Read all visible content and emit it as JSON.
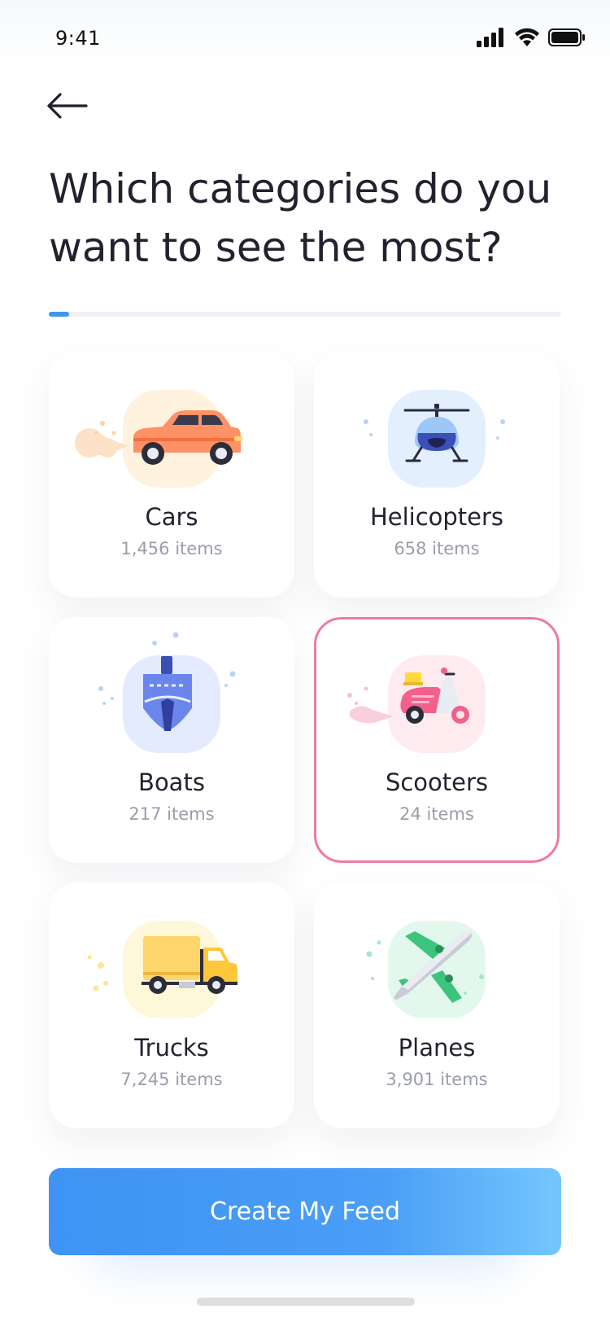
{
  "status_bar": {
    "time": "9:41"
  },
  "header": {
    "title": "Which categories do you want to see the most?"
  },
  "progress": {
    "fraction": 0.04
  },
  "categories": [
    {
      "name": "Cars",
      "count": "1,456 items",
      "icon": "car-icon",
      "color": "#fff2de"
    },
    {
      "name": "Helicopters",
      "count": "658 items",
      "icon": "helicopter-icon",
      "color": "#e3effd"
    },
    {
      "name": "Boats",
      "count": "217 items",
      "icon": "boat-icon",
      "color": "#e3ebfd"
    },
    {
      "name": "Scooters",
      "count": "24 items",
      "icon": "scooter-icon",
      "color": "#feebf0",
      "selected": true
    },
    {
      "name": "Trucks",
      "count": "7,245 items",
      "icon": "truck-icon",
      "color": "#fff7d9"
    },
    {
      "name": "Planes",
      "count": "3,901 items",
      "icon": "plane-icon",
      "color": "#e3f8ec"
    }
  ],
  "cta": {
    "label": "Create My Feed"
  },
  "colors": {
    "accent": "#3f95f4",
    "selected_border": "#ef7aa0"
  }
}
